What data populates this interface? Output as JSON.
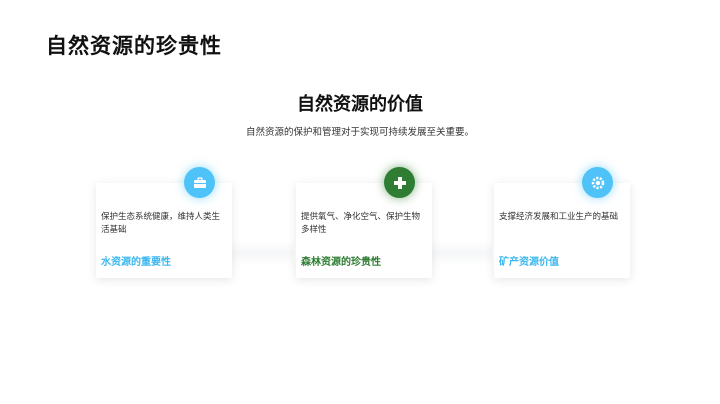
{
  "header": {
    "title": "自然资源的珍贵性"
  },
  "section": {
    "title": "自然资源的价值",
    "subtitle": "自然资源的保护和管理对于实现可持续发展至关重要。"
  },
  "cards": [
    {
      "icon": "briefcase-icon",
      "icon_color": "#4fc3f7",
      "text": "保护生态系统健康，维持人类生活基础",
      "label": "水资源的重要性",
      "label_color": "#3cb8ee"
    },
    {
      "icon": "first-aid-cross-icon",
      "icon_color": "#2e7d32",
      "text": "提供氧气、净化空气、保护生物多样性",
      "label": "森林资源的珍贵性",
      "label_color": "#2e7d32"
    },
    {
      "icon": "gear-icon",
      "icon_color": "#4fc3f7",
      "text": "支撑经济发展和工业生产的基础",
      "label": "矿产资源价值",
      "label_color": "#3cb8ee"
    }
  ]
}
